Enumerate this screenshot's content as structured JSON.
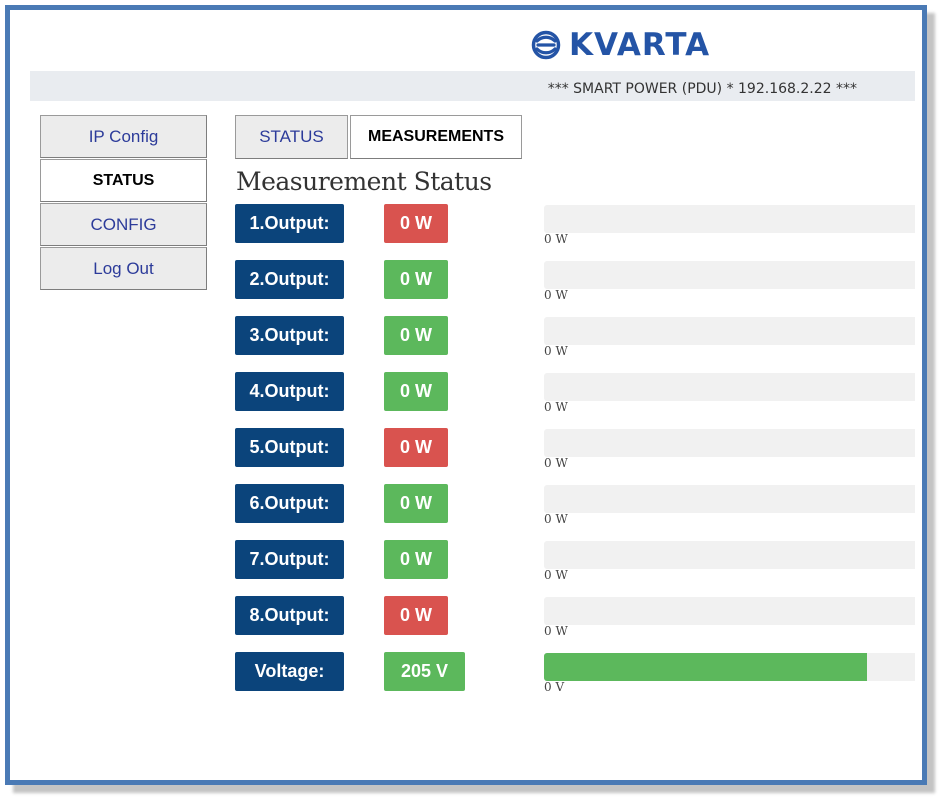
{
  "brand": {
    "name": "KVARTA",
    "logo_icon": "kvarta-swirl-logo",
    "color": "#2454a6"
  },
  "banner": {
    "text": "*** SMART POWER (PDU) * 192.168.2.22 ***"
  },
  "sidebar": {
    "items": [
      {
        "label": "IP Config",
        "active": false
      },
      {
        "label": "STATUS",
        "active": true
      },
      {
        "label": "CONFIG",
        "active": false
      },
      {
        "label": "Log Out",
        "active": false
      }
    ]
  },
  "tabs": [
    {
      "label": "STATUS",
      "active": false
    },
    {
      "label": "MEASUREMENTS",
      "active": true
    }
  ],
  "heading": "Measurement Status",
  "colors": {
    "on": "#5cb85c",
    "off": "#d9534f",
    "label_bg": "#0b447b"
  },
  "measurements": [
    {
      "label": "1.Output:",
      "value": "0 W",
      "state": "off",
      "bar_text": "0 W",
      "level": 0
    },
    {
      "label": "2.Output:",
      "value": "0 W",
      "state": "on",
      "bar_text": "0 W",
      "level": 0
    },
    {
      "label": "3.Output:",
      "value": "0 W",
      "state": "on",
      "bar_text": "0 W",
      "level": 0
    },
    {
      "label": "4.Output:",
      "value": "0 W",
      "state": "on",
      "bar_text": "0 W",
      "level": 0
    },
    {
      "label": "5.Output:",
      "value": "0 W",
      "state": "off",
      "bar_text": "0 W",
      "level": 0
    },
    {
      "label": "6.Output:",
      "value": "0 W",
      "state": "on",
      "bar_text": "0 W",
      "level": 0
    },
    {
      "label": "7.Output:",
      "value": "0 W",
      "state": "on",
      "bar_text": "0 W",
      "level": 0
    },
    {
      "label": "8.Output:",
      "value": "0 W",
      "state": "off",
      "bar_text": "0 W",
      "level": 0
    },
    {
      "label": "Voltage:",
      "value": "205 V",
      "state": "on",
      "bar_text": "0 V",
      "level": 0.87
    }
  ]
}
